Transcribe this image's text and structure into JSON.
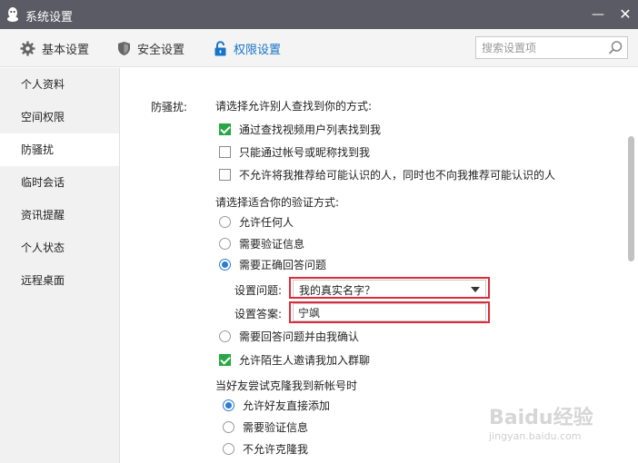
{
  "window": {
    "title": "系统设置",
    "minimize_label": "—",
    "close_label": "✕"
  },
  "tabs": [
    {
      "label": "基本设置",
      "icon": "gear-icon",
      "active": false
    },
    {
      "label": "安全设置",
      "icon": "shield-icon",
      "active": false
    },
    {
      "label": "权限设置",
      "icon": "lock-icon",
      "active": true
    }
  ],
  "search": {
    "placeholder": "搜索设置项"
  },
  "sidebar": {
    "items": [
      {
        "label": "个人资料",
        "active": false
      },
      {
        "label": "空间权限",
        "active": false
      },
      {
        "label": "防骚扰",
        "active": true
      },
      {
        "label": "临时会话",
        "active": false
      },
      {
        "label": "资讯提醒",
        "active": false
      },
      {
        "label": "个人状态",
        "active": false
      },
      {
        "label": "远程桌面",
        "active": false
      }
    ]
  },
  "main": {
    "section_label": "防骚扰:",
    "find_heading": "请选择允许别人查找到你的方式:",
    "find_options": [
      {
        "label": "通过查找视频用户列表找到我",
        "checked": true
      },
      {
        "label": "只能通过帐号或昵称找到我",
        "checked": false
      },
      {
        "label": "不允许将我推荐给可能认识的人，同时也不向我推荐可能认识的人",
        "checked": false
      }
    ],
    "verify_heading": "请选择适合你的验证方式:",
    "verify_options": [
      {
        "label": "允许任何人",
        "checked": false
      },
      {
        "label": "需要验证信息",
        "checked": false
      },
      {
        "label": "需要正确回答问题",
        "checked": true
      }
    ],
    "question_label": "设置问题:",
    "question_value": "我的真实名字？",
    "answer_label": "设置答案:",
    "answer_value": "宁飒",
    "verify_option_4": {
      "label": "需要回答问题并由我确认",
      "checked": false
    },
    "group_invite": {
      "label": "允许陌生人邀请我加入群聊",
      "checked": true
    },
    "clone_heading": "当好友尝试克隆我到新帐号时",
    "clone_options": [
      {
        "label": "允许好友直接添加",
        "checked": true
      },
      {
        "label": "需要验证信息",
        "checked": false
      },
      {
        "label": "不允许克隆我",
        "checked": false
      }
    ]
  },
  "watermark": {
    "main": "Baidu经验",
    "sub": "jingyan.baidu.com"
  },
  "colors": {
    "titlebar": "#5b5b66",
    "accent": "#1874c8",
    "checkbox_checked": "#28a745",
    "highlight": "#e02a3a"
  }
}
